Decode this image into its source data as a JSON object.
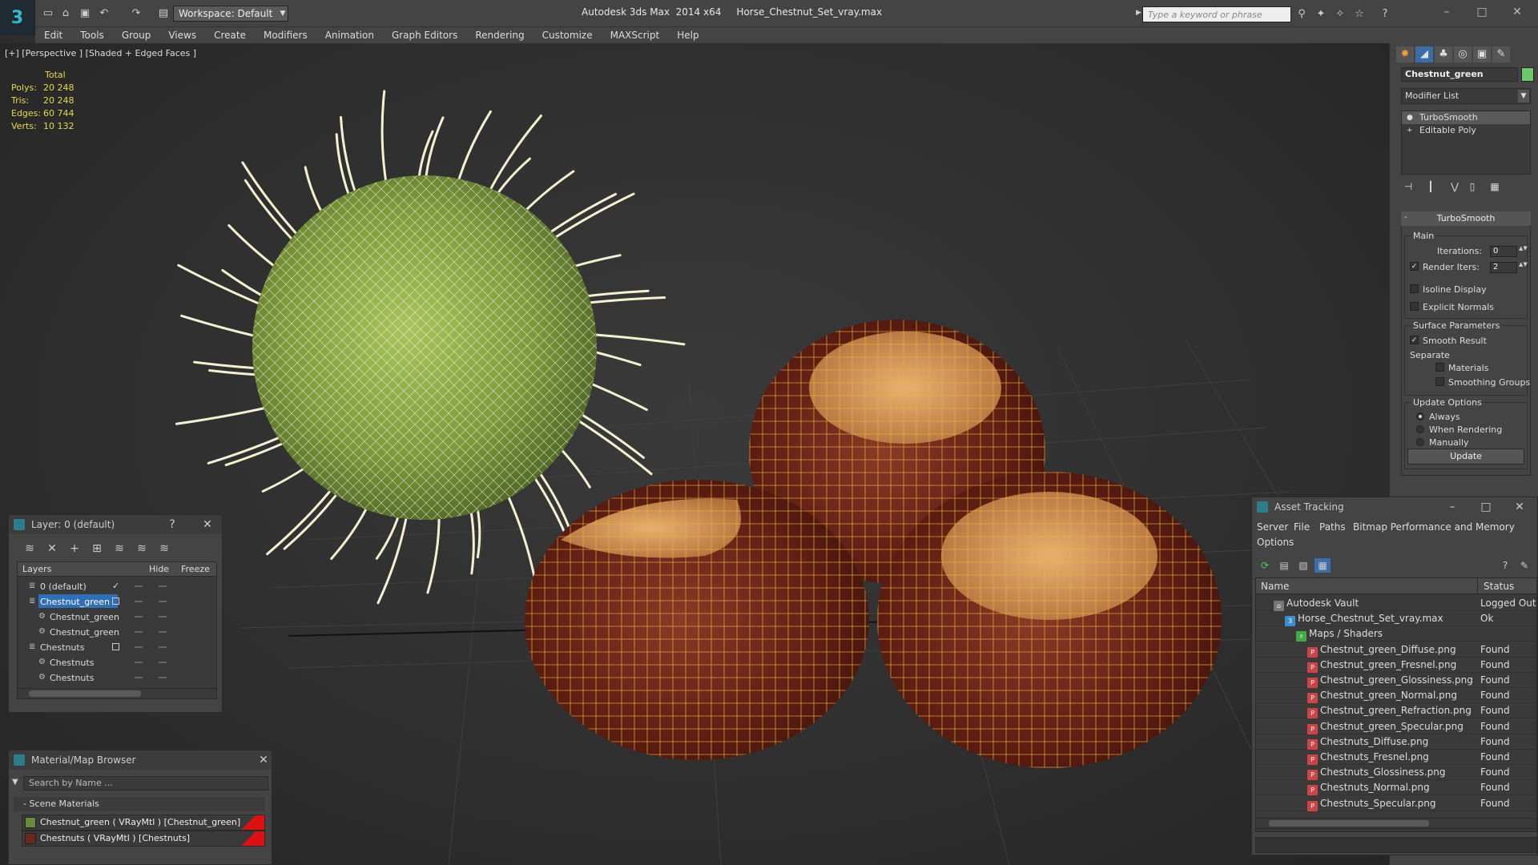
{
  "app": {
    "title": "Autodesk 3ds Max  2014 x64     Horse_Chestnut_Set_vray.max",
    "workspace": "Workspace: Default",
    "search_placeholder": "Type a keyword or phrase",
    "logo_text": "3"
  },
  "menu": [
    "Edit",
    "Tools",
    "Group",
    "Views",
    "Create",
    "Modifiers",
    "Animation",
    "Graph Editors",
    "Rendering",
    "Customize",
    "MAXScript",
    "Help"
  ],
  "viewport": {
    "label": "[+] [Perspective ] [Shaded + Edged Faces ]",
    "stats_header": "Total",
    "stats": [
      {
        "label": "Polys:",
        "value": "20 248"
      },
      {
        "label": "Tris:",
        "value": "20 248"
      },
      {
        "label": "Edges:",
        "value": "60 744"
      },
      {
        "label": "Verts:",
        "value": "10 132"
      }
    ]
  },
  "command_panel": {
    "object_name": "Chestnut_green",
    "object_color": "#6ec86a",
    "modifier_list": "Modifier List",
    "stack": [
      "TurboSmooth",
      "Editable Poly"
    ],
    "rollout_title": "TurboSmooth",
    "main_group": "Main",
    "iterations_label": "Iterations:",
    "iterations_value": "0",
    "render_iters_label": "Render Iters:",
    "render_iters_value": "2",
    "render_iters_checked": true,
    "isoline_display": "Isoline Display",
    "explicit_normals": "Explicit Normals",
    "surface_params": "Surface Parameters",
    "smooth_result": "Smooth Result",
    "separate": "Separate",
    "materials": "Materials",
    "smoothing_groups": "Smoothing Groups",
    "update_options": "Update Options",
    "always": "Always",
    "when_rendering": "When Rendering",
    "manually": "Manually",
    "update_button": "Update"
  },
  "layer_dialog": {
    "title": "Layer: 0 (default)",
    "help": "?",
    "col_layers": "Layers",
    "col_hide": "Hide",
    "col_freeze": "Freeze",
    "rows": [
      {
        "name": "0 (default)",
        "indent": 1,
        "active": true,
        "selected": false
      },
      {
        "name": "Chestnut_green",
        "indent": 1,
        "active": false,
        "selected": true
      },
      {
        "name": "Chestnut_green",
        "indent": 2,
        "active": false,
        "selected": false
      },
      {
        "name": "Chestnut_green",
        "indent": 2,
        "active": false,
        "selected": false
      },
      {
        "name": "Chestnuts",
        "indent": 1,
        "active": false,
        "selected": false
      },
      {
        "name": "Chestnuts",
        "indent": 2,
        "active": false,
        "selected": false
      },
      {
        "name": "Chestnuts",
        "indent": 2,
        "active": false,
        "selected": false
      }
    ]
  },
  "material_browser": {
    "title": "Material/Map Browser",
    "search_placeholder": "Search by Name ...",
    "section": "- Scene Materials",
    "materials": [
      {
        "name": "Chestnut_green  ( VRayMtl )  [Chestnut_green]",
        "swatch": "#6b8a3a"
      },
      {
        "name": "Chestnuts  ( VRayMtl )  [Chestnuts]",
        "swatch": "#6a2a1a"
      }
    ]
  },
  "asset_tracking": {
    "title": "Asset Tracking",
    "menu": [
      "Server",
      "File",
      "Paths",
      "Bitmap Performance and Memory",
      "Options"
    ],
    "col_name": "Name",
    "col_status": "Status",
    "rows": [
      {
        "name": "Autodesk Vault",
        "status": "Logged Out",
        "indent": 1,
        "icon": "vault"
      },
      {
        "name": "Horse_Chestnut_Set_vray.max",
        "status": "Ok",
        "indent": 2,
        "icon": "max"
      },
      {
        "name": "Maps / Shaders",
        "status": "",
        "indent": 3,
        "icon": "maps"
      },
      {
        "name": "Chestnut_green_Diffuse.png",
        "status": "Found",
        "indent": 4,
        "icon": "png"
      },
      {
        "name": "Chestnut_green_Fresnel.png",
        "status": "Found",
        "indent": 4,
        "icon": "png"
      },
      {
        "name": "Chestnut_green_Glossiness.png",
        "status": "Found",
        "indent": 4,
        "icon": "png"
      },
      {
        "name": "Chestnut_green_Normal.png",
        "status": "Found",
        "indent": 4,
        "icon": "png"
      },
      {
        "name": "Chestnut_green_Refraction.png",
        "status": "Found",
        "indent": 4,
        "icon": "png"
      },
      {
        "name": "Chestnut_green_Specular.png",
        "status": "Found",
        "indent": 4,
        "icon": "png"
      },
      {
        "name": "Chestnuts_Diffuse.png",
        "status": "Found",
        "indent": 4,
        "icon": "png"
      },
      {
        "name": "Chestnuts_Fresnel.png",
        "status": "Found",
        "indent": 4,
        "icon": "png"
      },
      {
        "name": "Chestnuts_Glossiness.png",
        "status": "Found",
        "indent": 4,
        "icon": "png"
      },
      {
        "name": "Chestnuts_Normal.png",
        "status": "Found",
        "indent": 4,
        "icon": "png"
      },
      {
        "name": "Chestnuts_Specular.png",
        "status": "Found",
        "indent": 4,
        "icon": "png"
      }
    ]
  }
}
